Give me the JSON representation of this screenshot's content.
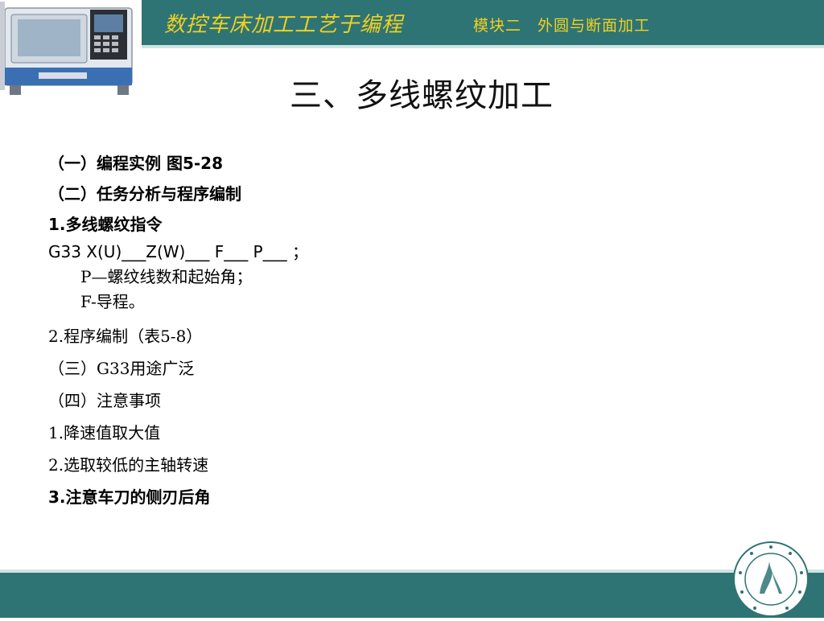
{
  "header": {
    "course_title": "数控车床加工工艺于编程",
    "module_title": "模块二　外圆与断面加工"
  },
  "slide": {
    "title": "三、多线螺纹加工"
  },
  "content": {
    "lines": [
      "（一）编程实例 图5-28",
      "（二）任务分析与程序编制",
      "1.多线螺纹指令",
      "G33 X(U)___Z(W)___ F___ P___ ；",
      "P—螺纹线数和起始角；",
      "F-导程。",
      "2.程序编制（表5-8）",
      "（三）G33用途广泛",
      "（四）注意事项",
      "1.降速值取大值",
      "2.选取较低的主轴转速",
      "3.注意车刀的侧刃后角"
    ]
  },
  "colors": {
    "band": "#2e7474",
    "header_text": "#f0d020"
  },
  "icons": {
    "machine_image": "cnc-lathe-illustration",
    "logo": "university-logo"
  }
}
